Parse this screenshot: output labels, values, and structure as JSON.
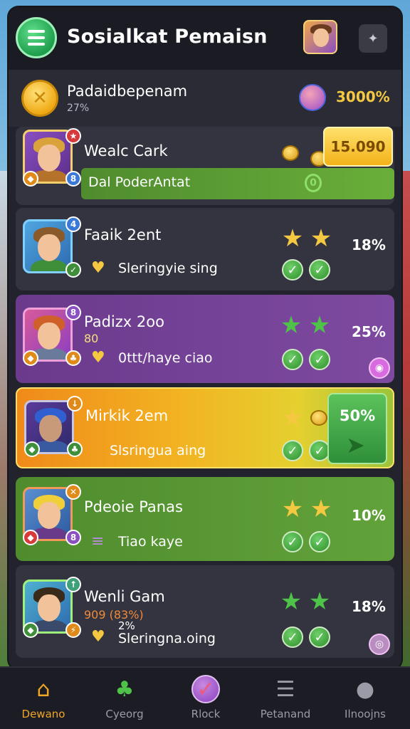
{
  "header": {
    "title": "Sosialkat Pemaisn",
    "menu_icon": "hamburger-menu-icon",
    "settings_icon": "settings-icon"
  },
  "summary": {
    "name": "Padaidbepenam",
    "sub": "27%",
    "percent": "3000%"
  },
  "top_player": {
    "name": "Wealc Cark",
    "score_button": "15.090",
    "bar_label": "Dal PoderAntat",
    "bar_value": "0"
  },
  "players": [
    {
      "name": "Faaik 2ent",
      "sub": "",
      "tag": "Sleringyie sing",
      "percent": "18%",
      "badge": "4"
    },
    {
      "name": "Padizx 2oo",
      "sub": "80",
      "tag": "0ttt/haye ciao",
      "percent": "25%",
      "badge": "8"
    },
    {
      "name": "Mirkik 2em",
      "sub": "",
      "tag": "Slsringua aing",
      "percent": "50%",
      "badge": ""
    },
    {
      "name": "Pdeoie Panas",
      "sub": "",
      "tag": "Tiao kaye",
      "percent": "10%",
      "badge": ""
    },
    {
      "name": "Wenli Gam",
      "sub": "909 (83%)",
      "sub2": "2%",
      "tag": "Sleringna.oing",
      "percent": "18%",
      "badge": ""
    }
  ],
  "colors": {
    "accent_gold": "#f5c842",
    "accent_green": "#4f8c2e",
    "panel_bg": "#22232c"
  },
  "bottom_nav": [
    {
      "label": "Dewano",
      "icon": "home-icon",
      "active": true
    },
    {
      "label": "Cyeorg",
      "icon": "gift-icon",
      "active": false
    },
    {
      "label": "Rlock",
      "icon": "check-badge-icon",
      "active": false
    },
    {
      "label": "Petanand",
      "icon": "list-icon",
      "active": false
    },
    {
      "label": "Ilnoojns",
      "icon": "profile-icon",
      "active": false
    }
  ]
}
